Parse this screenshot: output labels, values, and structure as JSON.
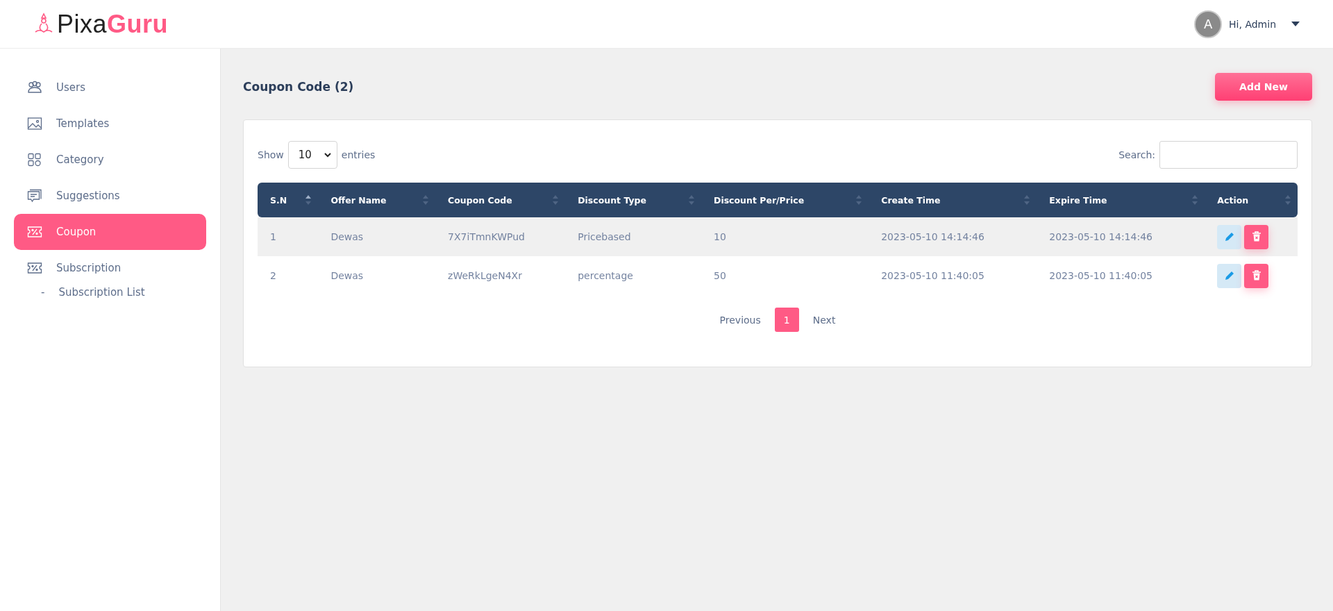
{
  "logo": {
    "first": "Pixa",
    "second": "Guru"
  },
  "user": {
    "avatar": "A",
    "greeting": "Hi, Admin"
  },
  "sidebar": {
    "items": [
      {
        "label": "Users",
        "kind": "users",
        "selected": false
      },
      {
        "label": "Templates",
        "kind": "image",
        "selected": false
      },
      {
        "label": "Category",
        "kind": "grid",
        "selected": false
      },
      {
        "label": "Suggestions",
        "kind": "chat",
        "selected": false
      },
      {
        "label": "Coupon",
        "kind": "coupon",
        "selected": true
      },
      {
        "label": "Subscription",
        "kind": "coupon",
        "selected": false,
        "children": [
          {
            "bullet": "-",
            "label": "Subscription List",
            "selected": false
          }
        ]
      }
    ]
  },
  "page": {
    "title": "Coupon Code (2)",
    "add_button": "Add New"
  },
  "controls": {
    "show_label": "Show",
    "entries_value": "10",
    "entries_label": "entries",
    "search_label": "Search:"
  },
  "table": {
    "columns": [
      {
        "label": "S.N",
        "sorted": true
      },
      {
        "label": "Offer Name",
        "sorted": false
      },
      {
        "label": "Coupon Code",
        "sorted": false
      },
      {
        "label": "Discount Type",
        "sorted": false
      },
      {
        "label": "Discount Per/Price",
        "sorted": false
      },
      {
        "label": "Create Time",
        "sorted": false
      },
      {
        "label": "Expire Time",
        "sorted": false
      },
      {
        "label": "Action",
        "sorted": false
      }
    ],
    "rows": [
      [
        "1",
        "Dewas",
        "7X7iTmnKWPud",
        "Pricebased",
        "10",
        "2023-05-10 14:14:46",
        "2023-05-10 14:14:46"
      ],
      [
        "2",
        "Dewas",
        "zWeRkLgeN4Xr",
        "percentage",
        "50",
        "2023-05-10 11:40:05",
        "2023-05-10 11:40:05"
      ]
    ]
  },
  "pagination": {
    "previous": "Previous",
    "pages": [
      {
        "label": "1",
        "selected": true
      }
    ],
    "next": "Next"
  }
}
